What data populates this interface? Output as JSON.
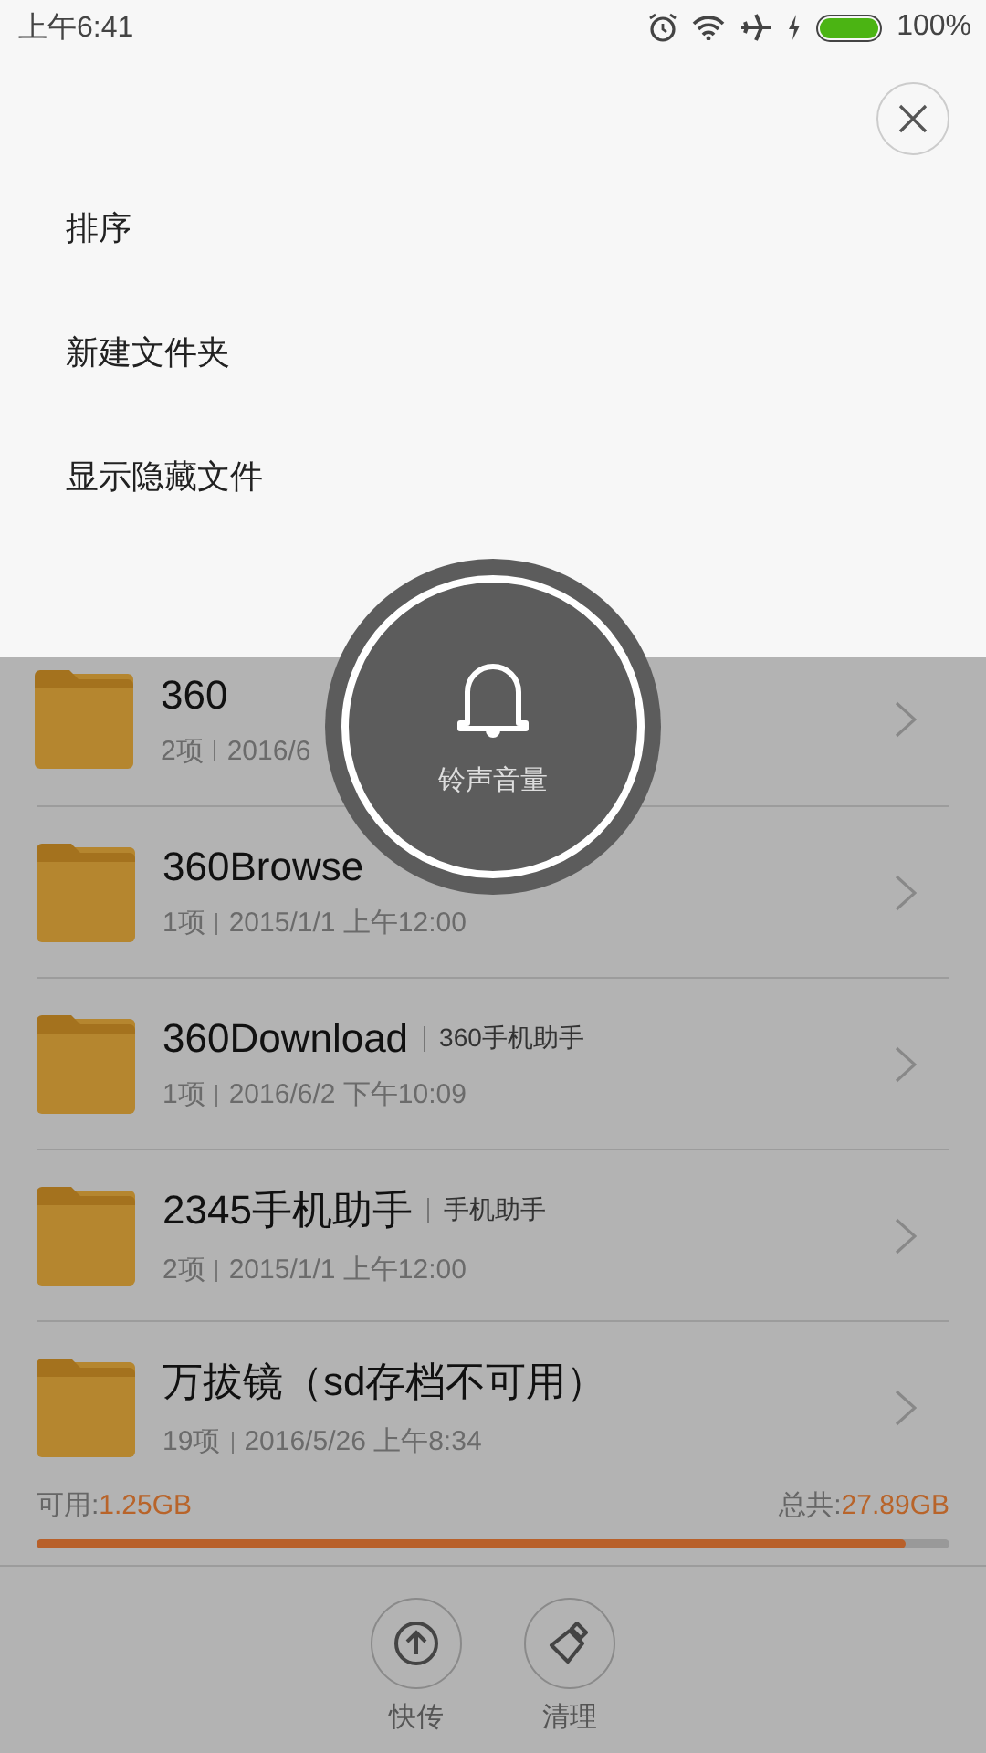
{
  "status_bar": {
    "time": "上午6:41",
    "battery": "100%"
  },
  "menu": {
    "items": [
      {
        "label": "排序"
      },
      {
        "label": "新建文件夹"
      },
      {
        "label": "显示隐藏文件"
      }
    ]
  },
  "files": [
    {
      "name": "360",
      "items": "2项",
      "date": "2016/6"
    },
    {
      "name": "360Browse",
      "items": "1项",
      "date": "2015/1/1 上午12:00"
    },
    {
      "name": "360Download",
      "tag": "360手机助手",
      "items": "1项",
      "date": "2016/6/2 下午10:09"
    },
    {
      "name": "2345手机助手",
      "tag": "手机助手",
      "items": "2项",
      "date": "2015/1/1 上午12:00"
    },
    {
      "name": "万拔镜（sd存档不可用）",
      "items": "19项",
      "date": "2016/5/26 上午8:34"
    }
  ],
  "storage": {
    "available_label": "可用:",
    "available": "1.25GB",
    "total_label": "总共:",
    "total": "27.89GB",
    "level": 0.952
  },
  "actions": [
    {
      "kind": "upload",
      "label": "快传"
    },
    {
      "kind": "clean",
      "label": "清理"
    }
  ],
  "volume_popup": {
    "label": "铃声音量"
  }
}
